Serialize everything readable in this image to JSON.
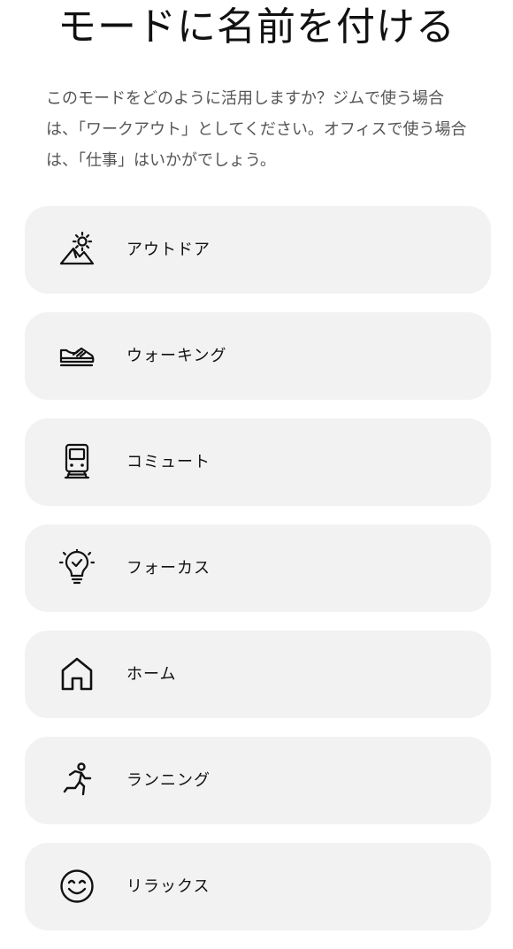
{
  "header": {
    "title": "モードに名前を付ける",
    "description": "このモードをどのように活用しますか？ジムで使う場合は、「ワークアウト」としてください。オフィスで使う場合は、「仕事」はいかがでしょう。"
  },
  "modes": [
    {
      "label": "アウトドア",
      "icon": "outdoor-icon"
    },
    {
      "label": "ウォーキング",
      "icon": "sneaker-icon"
    },
    {
      "label": "コミュート",
      "icon": "train-icon"
    },
    {
      "label": "フォーカス",
      "icon": "lightbulb-check-icon"
    },
    {
      "label": "ホーム",
      "icon": "house-icon"
    },
    {
      "label": "ランニング",
      "icon": "runner-icon"
    },
    {
      "label": "リラックス",
      "icon": "smiley-icon"
    }
  ]
}
